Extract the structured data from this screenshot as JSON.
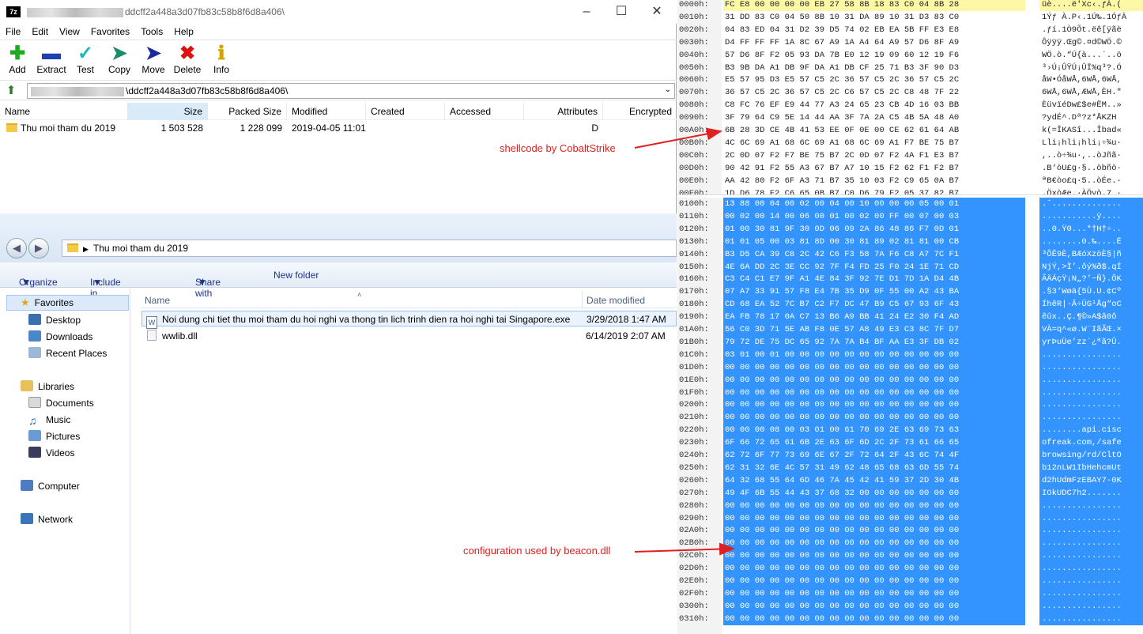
{
  "zip": {
    "title_path": "ddcff2a448a3d07fb83c58b8f6d8a406\\",
    "app_icon": "7-zip-icon",
    "menu": [
      "File",
      "Edit",
      "View",
      "Favorites",
      "Tools",
      "Help"
    ],
    "toolbar": [
      {
        "label": "Add",
        "icon": "plus-icon",
        "color": "#1faa1f"
      },
      {
        "label": "Extract",
        "icon": "minus-icon",
        "color": "#1d3fb0"
      },
      {
        "label": "Test",
        "icon": "check-icon",
        "color": "#1ab6c4"
      },
      {
        "label": "Copy",
        "icon": "copy-arrow-icon",
        "color": "#1b8c6c"
      },
      {
        "label": "Move",
        "icon": "move-arrow-icon",
        "color": "#1a2a9c"
      },
      {
        "label": "Delete",
        "icon": "delete-x-icon",
        "color": "#d11"
      },
      {
        "label": "Info",
        "icon": "info-icon",
        "color": "#d3a400"
      }
    ],
    "address": "\\ddcff2a448a3d07fb83c58b8f6d8a406\\",
    "columns": [
      "Name",
      "Size",
      "Packed Size",
      "Modified",
      "Created",
      "Accessed",
      "Attributes",
      "Encrypted"
    ],
    "rows": [
      {
        "name": "Thu moi tham du 2019",
        "size": "1 503 528",
        "packed": "1 228 099",
        "modified": "2019-04-05 11:01",
        "created": "",
        "accessed": "",
        "attributes": "D",
        "encrypted": ""
      }
    ]
  },
  "explorer": {
    "breadcrumb": "Thu moi tham du 2019",
    "commands": [
      "Organize",
      "Include in library",
      "Share with",
      "New folder"
    ],
    "nav": {
      "favorites": "Favorites",
      "fav_items": [
        "Desktop",
        "Downloads",
        "Recent Places"
      ],
      "libraries": "Libraries",
      "lib_items": [
        "Documents",
        "Music",
        "Pictures",
        "Videos"
      ],
      "computer": "Computer",
      "network": "Network"
    },
    "headers": {
      "name": "Name",
      "date": "Date modified"
    },
    "files": [
      {
        "name": "Noi dung chi tiet thu moi tham du hoi nghi va thong tin lich trinh dien ra hoi nghi tai Singapore.exe",
        "date": "3/29/2018 1:47 AM",
        "icon": "word-exe-icon"
      },
      {
        "name": "wwlib.dll",
        "date": "6/14/2019 2:07 AM",
        "icon": "dll-icon"
      }
    ]
  },
  "hex_top": [
    {
      "off": "0000h:",
      "bytes": "FC E8 00 00 00 00 EB 27 58 8B 18 83 C0 04 8B 28",
      "asc": "üè....ë'Xc‹.ƒÀ.(",
      "hl": true
    },
    {
      "off": "0010h:",
      "bytes": "31 DD 83 C0 04 50 8B 10 31 DA 89 10 31 D3 83 C0",
      "asc": "1Ýƒ À.P‹.1Ú‰.1ÓƒÀ"
    },
    {
      "off": "0020h:",
      "bytes": "04 83 ED 04 31 D2 39 D5 74 02 EB EA 5B FF E3 E8",
      "asc": ".ƒí.1Ò9Õt.ëê[ÿãè"
    },
    {
      "off": "0030h:",
      "bytes": "D4 FF FF FF 1A 8C 67 A9 1A A4 64 A9 57 D6 8F A9",
      "asc": "Ôÿÿÿ.Œg©.¤d©WÖ.©"
    },
    {
      "off": "0040h:",
      "bytes": "57 D6 8F F2 05 93 DA 7B E0 12 19 09 60 12 19 F6",
      "asc": "WÖ.ò.“Ú{à...`..ö"
    },
    {
      "off": "0050h:",
      "bytes": "B3 9B DA A1 DB 9F DA A1 DB CF 25 71 B3 3F 90 D3",
      "asc": "³›Ú¡ÛŸÚ¡ÛÏ%q³?.Ó"
    },
    {
      "off": "0060h:",
      "bytes": "E5 57 95 D3 E5 57 C5 2C 36 57 C5 2C 36 57 C5 2C",
      "asc": "åW•ÓåWÅ,6WÅ,6WÅ,"
    },
    {
      "off": "0070h:",
      "bytes": "36 57 C5 2C 36 57 C5 2C C6 57 C5 2C C8 48 7F 22",
      "asc": "6WÅ,6WÅ,ÆWÅ,ÈH.\""
    },
    {
      "off": "0080h:",
      "bytes": "C8 FC 76 EF E9 44 77 A3 24 65 23 CB 4D 16 03 BB",
      "asc": "ÈüvïéDw£$e#ËM..»"
    },
    {
      "off": "0090h:",
      "bytes": "3F 79 64 C9 5E 14 44 AA 3F 7A 2A C5 4B 5A 48 A0",
      "asc": "?ydÉ^.Dª?z*ÅKZH "
    },
    {
      "off": "00A0h:",
      "bytes": "6B 28 3D CE 4B 41 53 EE 0F 0E 00 CE 62 61 64 AB",
      "asc": "k(=ÎKASî...Îbad«"
    },
    {
      "off": "00B0h:",
      "bytes": "4C 6C 69 A1 68 6C 69 A1 68 6C 69 A1 F7 BE 75 B7",
      "asc": "Lli¡hli¡hli¡÷¾u·"
    },
    {
      "off": "00C0h:",
      "bytes": "2C 0D 07 F2 F7 BE 75 B7 2C 0D 07 F2 4A F1 E3 B7",
      "asc": ",..ò÷¾u·,..òJñã·"
    },
    {
      "off": "00D0h:",
      "bytes": "90 42 91 F2 55 A3 67 B7 A7 10 15 F2 62 F1 F2 B7",
      "asc": ".B‘òU£g·§..òbñò·"
    },
    {
      "off": "00E0h:",
      "bytes": "AA 42 80 F2 6F A3 71 B7 35 10 03 F2 C9 65 0A B7",
      "asc": "ªB€òo£q·5..òÉe.·"
    },
    {
      "off": "00F0h:",
      "bytes": "1D D6 78 F2 C6 65 0B B7 C0 D6 79 F2 05 37 82 B7",
      "asc": ".ÖxòÆe.·ÀÖyò.7‚·"
    }
  ],
  "hex_bottom": [
    {
      "off": "0100h:",
      "bytes": "13 88 00 04 00 02 00 04 00 10 00 00 00 05 00 01",
      "asc": ".ˆ..............",
      "sel": true
    },
    {
      "off": "0110h:",
      "bytes": "00 02 00 14 00 06 00 01 00 02 00 FF 00 07 00 03",
      "asc": "...........ÿ....",
      "sel": true
    },
    {
      "off": "0120h:",
      "bytes": "01 00 30 81 9F 30 0D 06 09 2A 86 48 86 F7 0D 01",
      "asc": "..0.Ÿ0...*†H†÷..",
      "sel": true
    },
    {
      "off": "0130h:",
      "bytes": "01 01 05 00 03 81 8D 00 30 81 89 02 81 81 00 CB",
      "asc": "........0.‰....Ë",
      "sel": true
    },
    {
      "off": "0140h:",
      "bytes": "B3 D5 CA 39 C8 2C 42 C6 F3 58 7A F6 C8 A7 7C F1",
      "asc": "³ÕÊ9È,BÆóXzöÈ§|ñ",
      "sel": true
    },
    {
      "off": "0150h:",
      "bytes": "4E 6A DD 2C 3E CC 92 7F F4 FD 25 F0 24 1E 71 CD",
      "asc": "NjÝ,>Ì’.ôý%ð$.qÍ",
      "sel": true
    },
    {
      "off": "0160h:",
      "bytes": "C3 C4 C1 E7 9F A1 4E 84 3F 92 7E D1 7D 1A D4 4B",
      "asc": "ÃÄÁçŸ¡N„?’~Ñ}.ÔK",
      "sel": true
    },
    {
      "off": "0170h:",
      "bytes": "07 A7 33 91 57 F8 E4 7B 35 D9 0F 55 00 A2 43 BA",
      "asc": ".§3‘Wøä{5Ù.U.¢Cº",
      "sel": true
    },
    {
      "off": "0180h:",
      "bytes": "CD 68 EA 52 7C B7 C2 F7 DC 47 B9 C5 67 93 6F 43",
      "asc": "ÍhêR|·Â÷ÜG¹Åg“oC",
      "sel": true
    },
    {
      "off": "0190h:",
      "bytes": "EA FB 78 17 0A C7 13 B6 A9 BB 41 24 E2 30 F4 AD",
      "asc": "êûx..Ç.¶©»A$â0ô­",
      "sel": true
    },
    {
      "off": "01A0h:",
      "bytes": "56 C0 3D 71 5E AB F8 0E 57 A8 49 E3 C3 8C 7F D7",
      "asc": "VÀ=q^«ø.W¨IãÃŒ.×",
      "sel": true
    },
    {
      "off": "01B0h:",
      "bytes": "79 72 DE 75 DC 65 92 7A 7A B4 BF AA E3 3F DB 02",
      "asc": "yrÞuÜe’zz´¿ªã?Û.",
      "sel": true
    },
    {
      "off": "01C0h:",
      "bytes": "03 01 00 01 00 00 00 00 00 00 00 00 00 00 00 00",
      "asc": "................",
      "sel": true
    },
    {
      "off": "01D0h:",
      "bytes": "00 00 00 00 00 00 00 00 00 00 00 00 00 00 00 00",
      "asc": "................",
      "sel": true
    },
    {
      "off": "01E0h:",
      "bytes": "00 00 00 00 00 00 00 00 00 00 00 00 00 00 00 00",
      "asc": "................",
      "sel": true
    },
    {
      "off": "01F0h:",
      "bytes": "00 00 00 00 00 00 00 00 00 00 00 00 00 00 00 00",
      "asc": "................",
      "sel": true
    },
    {
      "off": "0200h:",
      "bytes": "00 00 00 00 00 00 00 00 00 00 00 00 00 00 00 00",
      "asc": "................",
      "sel": true
    },
    {
      "off": "0210h:",
      "bytes": "00 00 00 00 00 00 00 00 00 00 00 00 00 00 00 00",
      "asc": "................",
      "sel": true
    },
    {
      "off": "0220h:",
      "bytes": "00 00 00 08 00 03 01 00 61 70 69 2E 63 69 73 63",
      "asc": "........api.cisc",
      "sel": true
    },
    {
      "off": "0230h:",
      "bytes": "6F 66 72 65 61 6B 2E 63 6F 6D 2C 2F 73 61 66 65",
      "asc": "ofreak.com,/safe",
      "sel": true
    },
    {
      "off": "0240h:",
      "bytes": "62 72 6F 77 73 69 6E 67 2F 72 64 2F 43 6C 74 4F",
      "asc": "browsing/rd/CltO",
      "sel": true
    },
    {
      "off": "0250h:",
      "bytes": "62 31 32 6E 4C 57 31 49 62 48 65 68 63 6D 55 74",
      "asc": "b12nLW1IbHehcmUt",
      "sel": true
    },
    {
      "off": "0260h:",
      "bytes": "64 32 68 55 64 6D 46 7A 45 42 41 59 37 2D 30 4B",
      "asc": "d2hUdmFzEBAY7-0K",
      "sel": true
    },
    {
      "off": "0270h:",
      "bytes": "49 4F 6B 55 44 43 37 68 32 00 00 00 00 00 00 00",
      "asc": "IOkUDC7h2.......",
      "sel": true
    },
    {
      "off": "0280h:",
      "bytes": "00 00 00 00 00 00 00 00 00 00 00 00 00 00 00 00",
      "asc": "................",
      "sel": true
    },
    {
      "off": "0290h:",
      "bytes": "00 00 00 00 00 00 00 00 00 00 00 00 00 00 00 00",
      "asc": "................",
      "sel": true
    },
    {
      "off": "02A0h:",
      "bytes": "00 00 00 00 00 00 00 00 00 00 00 00 00 00 00 00",
      "asc": "................",
      "sel": true
    },
    {
      "off": "02B0h:",
      "bytes": "00 00 00 00 00 00 00 00 00 00 00 00 00 00 00 00",
      "asc": "................",
      "sel": true
    },
    {
      "off": "02C0h:",
      "bytes": "00 00 00 00 00 00 00 00 00 00 00 00 00 00 00 00",
      "asc": "................",
      "sel": true
    },
    {
      "off": "02D0h:",
      "bytes": "00 00 00 00 00 00 00 00 00 00 00 00 00 00 00 00",
      "asc": "................",
      "sel": true
    },
    {
      "off": "02E0h:",
      "bytes": "00 00 00 00 00 00 00 00 00 00 00 00 00 00 00 00",
      "asc": "................",
      "sel": true
    },
    {
      "off": "02F0h:",
      "bytes": "00 00 00 00 00 00 00 00 00 00 00 00 00 00 00 00",
      "asc": "................",
      "sel": true
    },
    {
      "off": "0300h:",
      "bytes": "00 00 00 00 00 00 00 00 00 00 00 00 00 00 00 00",
      "asc": "................",
      "sel": true
    },
    {
      "off": "0310h:",
      "bytes": "00 00 00 00 00 00 00 00 00 00 00 00 00 00 00 00",
      "asc": "................",
      "sel": true
    }
  ],
  "annotations": {
    "shellcode": "shellcode by CobaltStrike",
    "config": "configuration used by beacon.dll",
    "color": "#e02020"
  }
}
